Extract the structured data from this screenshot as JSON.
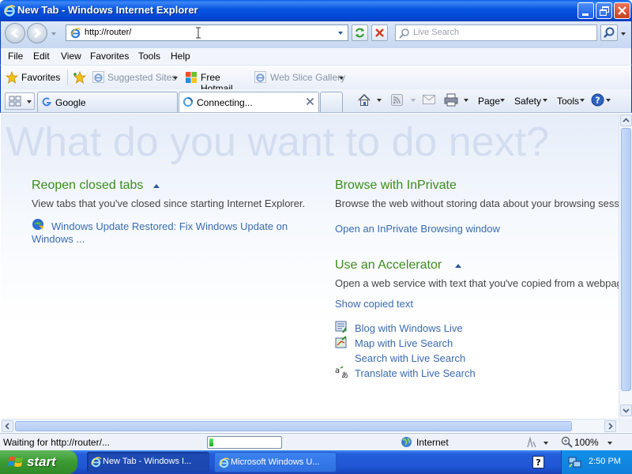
{
  "window": {
    "title": "New Tab - Windows Internet Explorer"
  },
  "nav": {
    "address": "http://router/",
    "search_placeholder": "Live Search"
  },
  "menu": [
    "File",
    "Edit",
    "View",
    "Favorites",
    "Tools",
    "Help"
  ],
  "favorites_bar": {
    "favorites_label": "Favorites",
    "items": [
      {
        "label": "Suggested Sites",
        "icon": "ie-icon"
      },
      {
        "label": "Free Hotmail",
        "icon": "windows-flag-icon"
      },
      {
        "label": "Web Slice Gallery",
        "icon": "ie-icon"
      }
    ]
  },
  "tabs": [
    {
      "label": "Google",
      "icon": "google-icon"
    },
    {
      "label": "Connecting...",
      "icon": "loading-icon"
    }
  ],
  "command_bar": {
    "page": "Page",
    "safety": "Safety",
    "tools": "Tools"
  },
  "content": {
    "watermark": "What do you want to do next?",
    "reopen": {
      "title": "Reopen closed tabs",
      "description": "View tabs that you've closed since starting Internet Explorer.",
      "link": "Windows Update Restored: Fix Windows Update on",
      "link_cont": "Windows ..."
    },
    "inprivate": {
      "title": "Browse with InPrivate",
      "description": "Browse the web without storing data about your browsing sess",
      "link": "Open an InPrivate Browsing window"
    },
    "accelerator": {
      "title": "Use an Accelerator",
      "description": "Open a web service with text that you've copied from a webpag",
      "show_copied": "Show copied text",
      "items": [
        {
          "label": "Blog with Windows Live",
          "icon": "blog-icon"
        },
        {
          "label": "Map with Live Search",
          "icon": "map-icon"
        },
        {
          "label": "Search with Live Search",
          "icon": ""
        },
        {
          "label": "Translate with Live Search",
          "icon": "translate-icon"
        }
      ]
    }
  },
  "status": {
    "text": "Waiting for http://router/...",
    "progress": 0.06,
    "zone": "Internet",
    "zoom": "100%"
  },
  "taskbar": {
    "start": "start",
    "tasks": [
      "New Tab - Windows I...",
      "Microsoft Windows U..."
    ],
    "time": "2:50 PM"
  }
}
